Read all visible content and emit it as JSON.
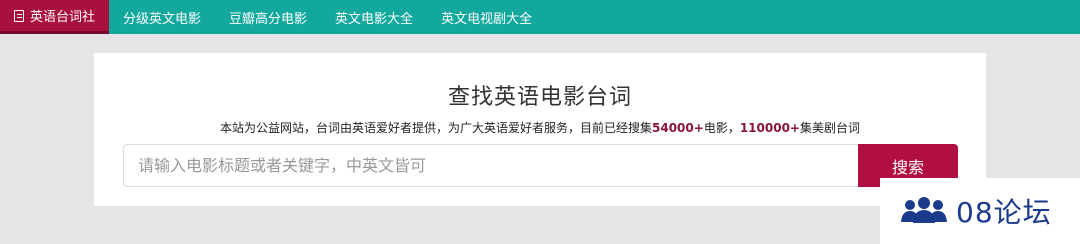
{
  "nav": {
    "brand_label": "英语台词社",
    "links": [
      "分级英文电影",
      "豆瓣高分电影",
      "英文电影大全",
      "英文电视剧大全"
    ]
  },
  "main": {
    "title": "查找英语电影台词",
    "subtitle_prefix": "本站为公益网站，台词由英语爱好者提供，为广大英语爱好者服务，目前已经搜集",
    "movie_count": "54000+",
    "subtitle_mid": "电影，",
    "series_count": "110000+",
    "subtitle_suffix": "集美剧台词",
    "search": {
      "placeholder": "请输入电影标题或者关键字，中英文皆可",
      "value": "",
      "button_label": "搜索"
    }
  },
  "watermark": {
    "text": "08论坛",
    "icon": "users-group-icon"
  },
  "colors": {
    "nav_bg": "#13a89e",
    "brand_bg": "#a8103e",
    "accent": "#b10f41",
    "highlight": "#8a1538",
    "page_bg": "#e5e5e5",
    "watermark": "#1b3a8c"
  }
}
